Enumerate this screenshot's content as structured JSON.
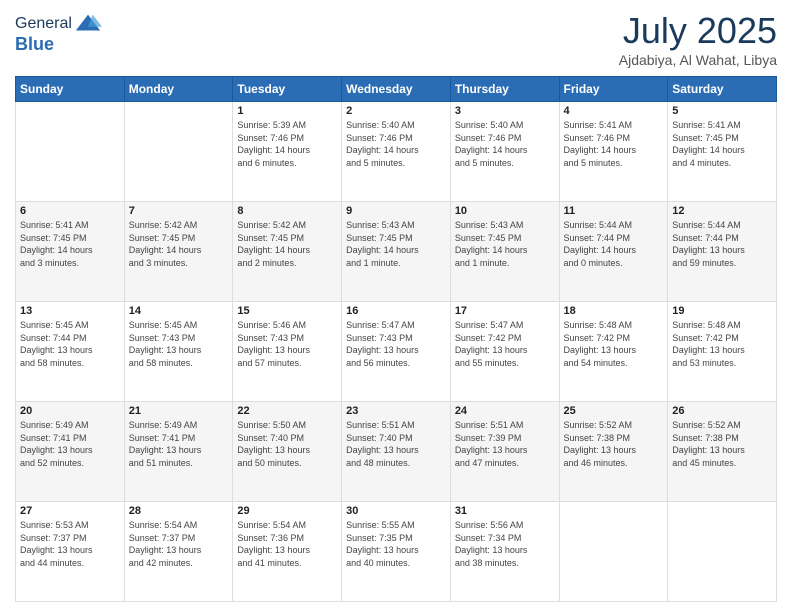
{
  "header": {
    "logo_line1": "General",
    "logo_line2": "Blue",
    "month": "July 2025",
    "location": "Ajdabiya, Al Wahat, Libya"
  },
  "days_of_week": [
    "Sunday",
    "Monday",
    "Tuesday",
    "Wednesday",
    "Thursday",
    "Friday",
    "Saturday"
  ],
  "weeks": [
    [
      {
        "day": "",
        "info": ""
      },
      {
        "day": "",
        "info": ""
      },
      {
        "day": "1",
        "info": "Sunrise: 5:39 AM\nSunset: 7:46 PM\nDaylight: 14 hours\nand 6 minutes."
      },
      {
        "day": "2",
        "info": "Sunrise: 5:40 AM\nSunset: 7:46 PM\nDaylight: 14 hours\nand 5 minutes."
      },
      {
        "day": "3",
        "info": "Sunrise: 5:40 AM\nSunset: 7:46 PM\nDaylight: 14 hours\nand 5 minutes."
      },
      {
        "day": "4",
        "info": "Sunrise: 5:41 AM\nSunset: 7:46 PM\nDaylight: 14 hours\nand 5 minutes."
      },
      {
        "day": "5",
        "info": "Sunrise: 5:41 AM\nSunset: 7:45 PM\nDaylight: 14 hours\nand 4 minutes."
      }
    ],
    [
      {
        "day": "6",
        "info": "Sunrise: 5:41 AM\nSunset: 7:45 PM\nDaylight: 14 hours\nand 3 minutes."
      },
      {
        "day": "7",
        "info": "Sunrise: 5:42 AM\nSunset: 7:45 PM\nDaylight: 14 hours\nand 3 minutes."
      },
      {
        "day": "8",
        "info": "Sunrise: 5:42 AM\nSunset: 7:45 PM\nDaylight: 14 hours\nand 2 minutes."
      },
      {
        "day": "9",
        "info": "Sunrise: 5:43 AM\nSunset: 7:45 PM\nDaylight: 14 hours\nand 1 minute."
      },
      {
        "day": "10",
        "info": "Sunrise: 5:43 AM\nSunset: 7:45 PM\nDaylight: 14 hours\nand 1 minute."
      },
      {
        "day": "11",
        "info": "Sunrise: 5:44 AM\nSunset: 7:44 PM\nDaylight: 14 hours\nand 0 minutes."
      },
      {
        "day": "12",
        "info": "Sunrise: 5:44 AM\nSunset: 7:44 PM\nDaylight: 13 hours\nand 59 minutes."
      }
    ],
    [
      {
        "day": "13",
        "info": "Sunrise: 5:45 AM\nSunset: 7:44 PM\nDaylight: 13 hours\nand 58 minutes."
      },
      {
        "day": "14",
        "info": "Sunrise: 5:45 AM\nSunset: 7:43 PM\nDaylight: 13 hours\nand 58 minutes."
      },
      {
        "day": "15",
        "info": "Sunrise: 5:46 AM\nSunset: 7:43 PM\nDaylight: 13 hours\nand 57 minutes."
      },
      {
        "day": "16",
        "info": "Sunrise: 5:47 AM\nSunset: 7:43 PM\nDaylight: 13 hours\nand 56 minutes."
      },
      {
        "day": "17",
        "info": "Sunrise: 5:47 AM\nSunset: 7:42 PM\nDaylight: 13 hours\nand 55 minutes."
      },
      {
        "day": "18",
        "info": "Sunrise: 5:48 AM\nSunset: 7:42 PM\nDaylight: 13 hours\nand 54 minutes."
      },
      {
        "day": "19",
        "info": "Sunrise: 5:48 AM\nSunset: 7:42 PM\nDaylight: 13 hours\nand 53 minutes."
      }
    ],
    [
      {
        "day": "20",
        "info": "Sunrise: 5:49 AM\nSunset: 7:41 PM\nDaylight: 13 hours\nand 52 minutes."
      },
      {
        "day": "21",
        "info": "Sunrise: 5:49 AM\nSunset: 7:41 PM\nDaylight: 13 hours\nand 51 minutes."
      },
      {
        "day": "22",
        "info": "Sunrise: 5:50 AM\nSunset: 7:40 PM\nDaylight: 13 hours\nand 50 minutes."
      },
      {
        "day": "23",
        "info": "Sunrise: 5:51 AM\nSunset: 7:40 PM\nDaylight: 13 hours\nand 48 minutes."
      },
      {
        "day": "24",
        "info": "Sunrise: 5:51 AM\nSunset: 7:39 PM\nDaylight: 13 hours\nand 47 minutes."
      },
      {
        "day": "25",
        "info": "Sunrise: 5:52 AM\nSunset: 7:38 PM\nDaylight: 13 hours\nand 46 minutes."
      },
      {
        "day": "26",
        "info": "Sunrise: 5:52 AM\nSunset: 7:38 PM\nDaylight: 13 hours\nand 45 minutes."
      }
    ],
    [
      {
        "day": "27",
        "info": "Sunrise: 5:53 AM\nSunset: 7:37 PM\nDaylight: 13 hours\nand 44 minutes."
      },
      {
        "day": "28",
        "info": "Sunrise: 5:54 AM\nSunset: 7:37 PM\nDaylight: 13 hours\nand 42 minutes."
      },
      {
        "day": "29",
        "info": "Sunrise: 5:54 AM\nSunset: 7:36 PM\nDaylight: 13 hours\nand 41 minutes."
      },
      {
        "day": "30",
        "info": "Sunrise: 5:55 AM\nSunset: 7:35 PM\nDaylight: 13 hours\nand 40 minutes."
      },
      {
        "day": "31",
        "info": "Sunrise: 5:56 AM\nSunset: 7:34 PM\nDaylight: 13 hours\nand 38 minutes."
      },
      {
        "day": "",
        "info": ""
      },
      {
        "day": "",
        "info": ""
      }
    ]
  ]
}
